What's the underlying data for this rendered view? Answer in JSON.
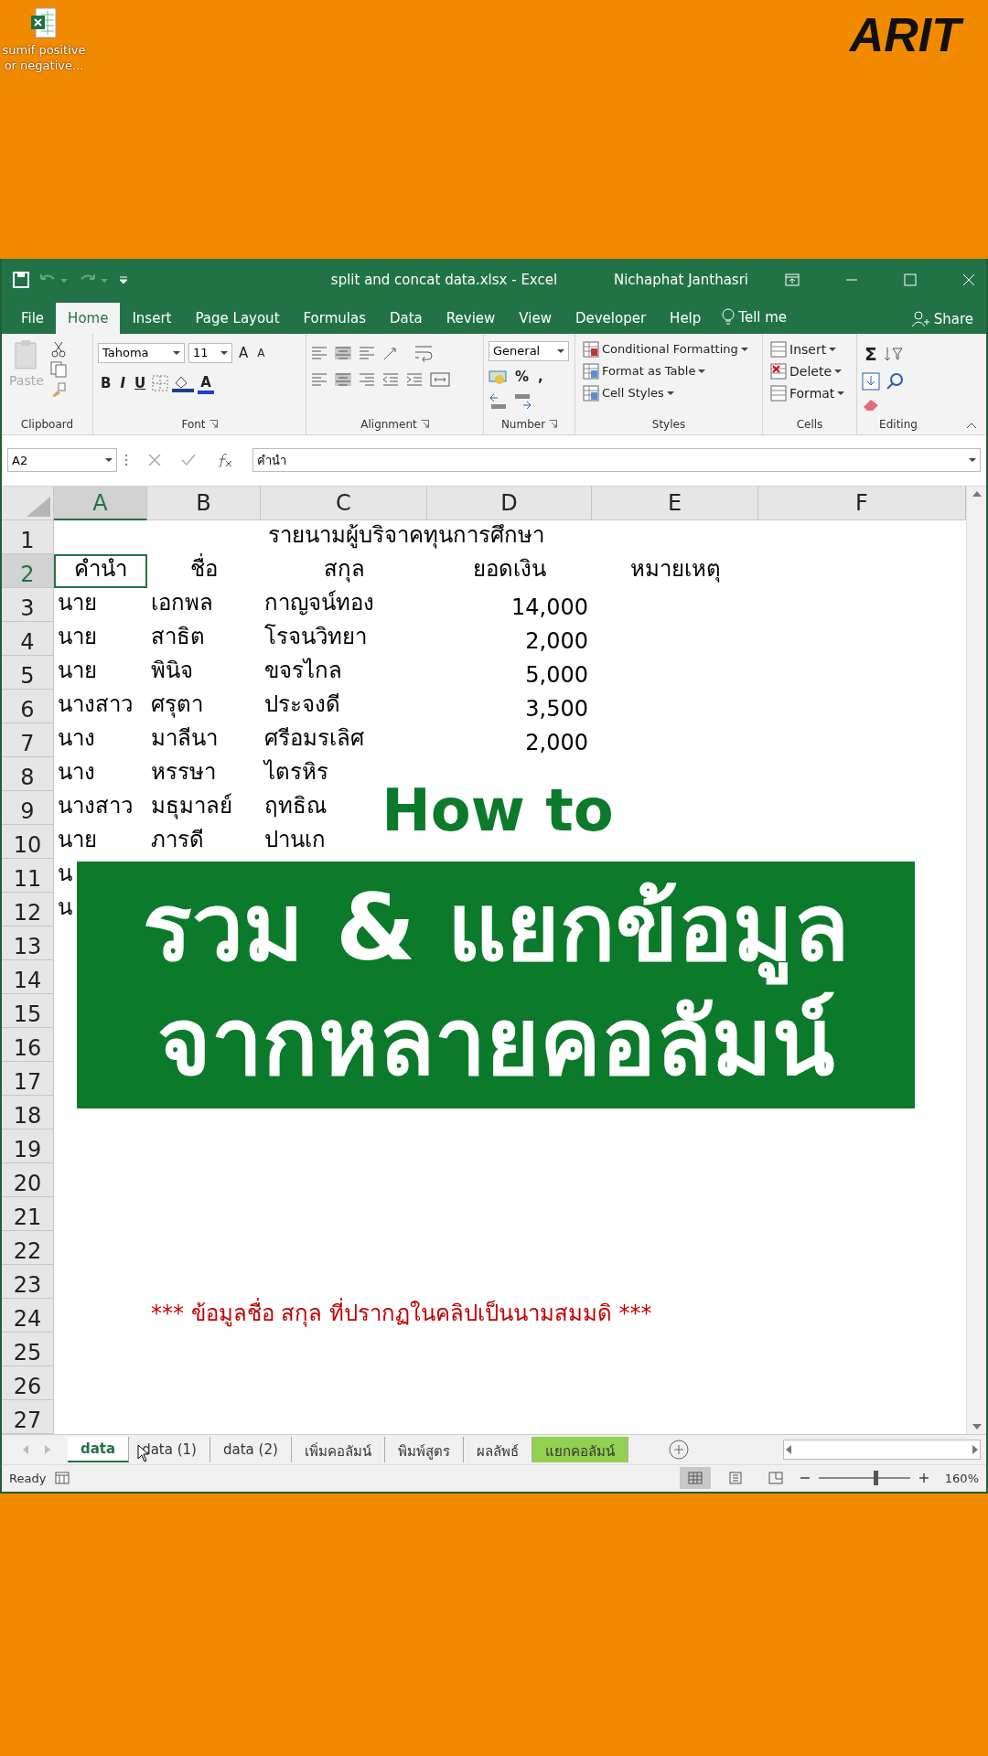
{
  "desktop": {
    "icon_label": "sumif positive or negative...",
    "logo": "ARIT"
  },
  "window": {
    "title": "split and concat data.xlsx  -  Excel",
    "user": "Nichaphat Janthasri"
  },
  "ribbon_tabs": [
    {
      "label": "File",
      "selected": false
    },
    {
      "label": "Home",
      "selected": true
    },
    {
      "label": "Insert",
      "selected": false
    },
    {
      "label": "Page Layout",
      "selected": false
    },
    {
      "label": "Formulas",
      "selected": false
    },
    {
      "label": "Data",
      "selected": false
    },
    {
      "label": "Review",
      "selected": false
    },
    {
      "label": "View",
      "selected": false
    },
    {
      "label": "Developer",
      "selected": false
    },
    {
      "label": "Help",
      "selected": false
    }
  ],
  "tell_me": "Tell me",
  "share": "Share",
  "ribbon": {
    "groups": [
      {
        "kind": "clipboard",
        "label": "Clipboard",
        "paste": "Paste",
        "paste_disabled": true
      },
      {
        "kind": "font",
        "label": "Font",
        "font_name": "Tahoma",
        "font_size": "11",
        "grow": "A",
        "shrink": "A",
        "bold": "B",
        "italic": "I",
        "underline": "U",
        "font_color": "A"
      },
      {
        "kind": "alignment",
        "label": "Alignment"
      },
      {
        "kind": "number",
        "label": "Number",
        "format": "General",
        "percent": "%",
        "comma": ","
      },
      {
        "kind": "styles",
        "label": "Styles",
        "items": [
          "Conditional Formatting",
          "Format as Table",
          "Cell Styles"
        ]
      },
      {
        "kind": "cells",
        "label": "Cells",
        "items": [
          "Insert",
          "Delete",
          "Format"
        ]
      },
      {
        "kind": "editing",
        "label": "Editing",
        "sum": "Σ"
      }
    ]
  },
  "formula_bar": {
    "name_box": "A2",
    "formula": "คำนำ"
  },
  "sheet": {
    "columns": [
      {
        "label": "A",
        "selected": true
      },
      {
        "label": "B",
        "selected": false
      },
      {
        "label": "C",
        "selected": false
      },
      {
        "label": "D",
        "selected": false
      },
      {
        "label": "E",
        "selected": false
      },
      {
        "label": "F",
        "selected": false
      }
    ],
    "rows": [
      {
        "number": "1",
        "selected": false,
        "kind": "title",
        "text": "รายนามผู้บริจาคทุนการศึกษา"
      },
      {
        "number": "2",
        "selected": true,
        "kind": "header",
        "cells": [
          {
            "text": "คำนำ",
            "selected": true
          },
          {
            "text": "ชื่อ",
            "selected": false
          },
          {
            "text": "สกุล",
            "selected": false
          },
          {
            "text": "ยอดเงิน",
            "selected": false
          },
          {
            "text": "หมายเหตุ",
            "selected": false
          }
        ]
      },
      {
        "number": "3",
        "selected": false,
        "kind": "data",
        "cells": [
          {
            "text": "นาย",
            "selected": false
          },
          {
            "text": "เอกพล",
            "selected": false
          },
          {
            "text": "กาญจน์ทอง",
            "selected": false
          },
          {
            "text": "14,000",
            "selected": false
          }
        ]
      },
      {
        "number": "4",
        "selected": false,
        "kind": "data",
        "cells": [
          {
            "text": "นาย",
            "selected": false
          },
          {
            "text": "สาธิต",
            "selected": false
          },
          {
            "text": "โรจนวิทยา",
            "selected": false
          },
          {
            "text": "2,000",
            "selected": false
          }
        ]
      },
      {
        "number": "5",
        "selected": false,
        "kind": "data",
        "cells": [
          {
            "text": "นาย",
            "selected": false
          },
          {
            "text": "พินิจ",
            "selected": false
          },
          {
            "text": "ขจรไกล",
            "selected": false
          },
          {
            "text": "5,000",
            "selected": false
          }
        ]
      },
      {
        "number": "6",
        "selected": false,
        "kind": "data",
        "cells": [
          {
            "text": "นางสาว",
            "selected": false
          },
          {
            "text": "ศรุตา",
            "selected": false
          },
          {
            "text": "ประจงดี",
            "selected": false
          },
          {
            "text": "3,500",
            "selected": false
          }
        ]
      },
      {
        "number": "7",
        "selected": false,
        "kind": "data",
        "cells": [
          {
            "text": "นาง",
            "selected": false
          },
          {
            "text": "มาลีนา",
            "selected": false
          },
          {
            "text": "ศรีอมรเลิศ",
            "selected": false
          },
          {
            "text": "2,000",
            "selected": false
          }
        ]
      },
      {
        "number": "8",
        "selected": false,
        "kind": "data",
        "cells": [
          {
            "text": "นาง",
            "selected": false
          },
          {
            "text": "หรรษา",
            "selected": false
          },
          {
            "text": "ไตรหิร",
            "selected": false
          }
        ]
      },
      {
        "number": "9",
        "selected": false,
        "kind": "data",
        "cells": [
          {
            "text": "นางสาว",
            "selected": false
          },
          {
            "text": "มธุมาลย์",
            "selected": false
          },
          {
            "text": "ฤทธิณ",
            "selected": false
          }
        ]
      },
      {
        "number": "10",
        "selected": false,
        "kind": "data",
        "cells": [
          {
            "text": "นาย",
            "selected": false
          },
          {
            "text": "ภารดี",
            "selected": false
          },
          {
            "text": "ปานเก",
            "selected": false
          }
        ]
      },
      {
        "number": "11",
        "selected": false,
        "kind": "data",
        "cells": [
          {
            "text": "น",
            "selected": false
          }
        ]
      },
      {
        "number": "12",
        "selected": false,
        "kind": "data",
        "cells": [
          {
            "text": "น",
            "selected": false
          }
        ]
      },
      {
        "number": "13",
        "selected": false,
        "kind": "empty"
      },
      {
        "number": "14",
        "selected": false,
        "kind": "empty"
      },
      {
        "number": "15",
        "selected": false,
        "kind": "empty"
      },
      {
        "number": "16",
        "selected": false,
        "kind": "empty"
      },
      {
        "number": "17",
        "selected": false,
        "kind": "empty"
      },
      {
        "number": "18",
        "selected": false,
        "kind": "empty"
      },
      {
        "number": "19",
        "selected": false,
        "kind": "empty"
      },
      {
        "number": "20",
        "selected": false,
        "kind": "empty"
      },
      {
        "number": "21",
        "selected": false,
        "kind": "empty"
      },
      {
        "number": "22",
        "selected": false,
        "kind": "empty"
      },
      {
        "number": "23",
        "selected": false,
        "kind": "empty"
      },
      {
        "number": "24",
        "selected": false,
        "kind": "note",
        "text": "*** ข้อมูลชื่อ สกุล ที่ปรากฏในคลิปเป็นนามสมมดิ ***"
      },
      {
        "number": "25",
        "selected": false,
        "kind": "empty"
      },
      {
        "number": "26",
        "selected": false,
        "kind": "empty"
      },
      {
        "number": "27",
        "selected": false,
        "kind": "empty"
      }
    ]
  },
  "overlay": {
    "how_to": "How to",
    "lines": [
      "รวม & แยกข้อมูล",
      "จากหลายคอลัมน์"
    ]
  },
  "sheet_tabs": [
    {
      "label": "data",
      "selected": true
    },
    {
      "label": "data (1)",
      "selected": false
    },
    {
      "label": "data (2)",
      "selected": false
    },
    {
      "label": "เพิ่มคอลัมน์",
      "selected": false
    },
    {
      "label": "พิมพ์สูตร",
      "selected": false
    },
    {
      "label": "ผลลัพธ์",
      "selected": false
    },
    {
      "label": "แยกคอลัมน์",
      "selected": false,
      "color": "#92d050"
    }
  ],
  "status_bar": {
    "status": "Ready",
    "zoom": {
      "level": 0.63,
      "reading": "160%"
    }
  }
}
